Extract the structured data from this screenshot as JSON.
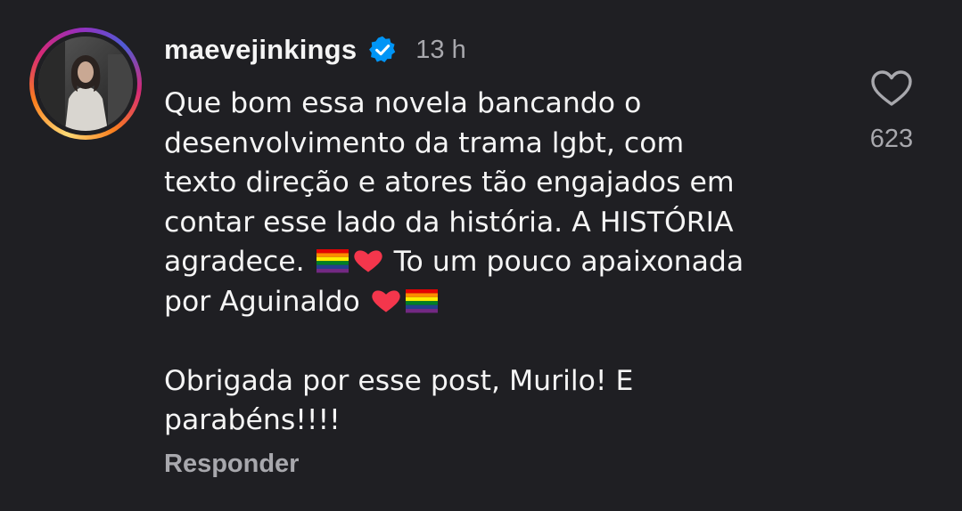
{
  "comment": {
    "username": "maevejinkings",
    "verified_icon": "verified-badge-icon",
    "time": "13 h",
    "lines": [
      "Que bom essa novela bancando o",
      "desenvolvimento da trama lgbt, com",
      "texto direção e atores tão engajados em",
      "contar esse lado da história. A HISTÓRIA"
    ],
    "line5_start": "agradece.",
    "line5_end": "To um pouco apaixonada",
    "line6_start": "por Aguinaldo",
    "line7": "Obrigada por esse post, Murilo! E",
    "line8": "parabéns!!!!",
    "emojis": [
      "rainbow-flag",
      "red-heart"
    ],
    "reply_label": "Responder",
    "like_icon": "heart-outline-icon",
    "like_count": "623"
  },
  "colors": {
    "background": "#1f1f23",
    "text": "#f5f5f5",
    "muted": "#a8a8ad",
    "verified": "#0095f6"
  }
}
